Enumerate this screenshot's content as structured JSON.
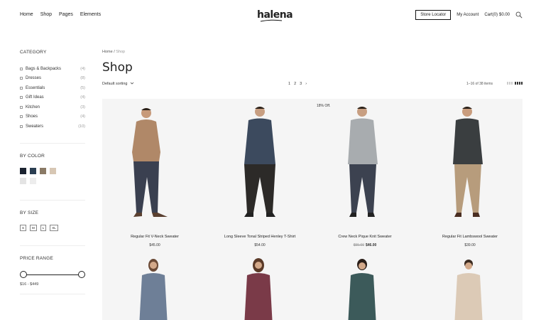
{
  "header": {
    "nav": [
      "Home",
      "Shop",
      "Pages",
      "Elements"
    ],
    "logo": "halena",
    "store_locator": "Store Locator",
    "my_account": "My Account",
    "cart_label": "Cart(0)",
    "cart_total": "$0.00"
  },
  "sidebar": {
    "category_title": "CATEGORY",
    "categories": [
      {
        "label": "Bags & Backpacks",
        "count": "(4)"
      },
      {
        "label": "Dresses",
        "count": "(8)"
      },
      {
        "label": "Essentials",
        "count": "(5)"
      },
      {
        "label": "Gift Ideas",
        "count": "(4)"
      },
      {
        "label": "Kitchen",
        "count": "(3)"
      },
      {
        "label": "Shoes",
        "count": "(4)"
      },
      {
        "label": "Sweaters",
        "count": "(10)"
      }
    ],
    "color_title": "BY COLOR",
    "colors": [
      "#1b2330",
      "#2b3e52",
      "#8a7a66",
      "#d7c7b4",
      "#e4e4e4",
      "#ededed"
    ],
    "size_title": "BY SIZE",
    "sizes": [
      "S",
      "M",
      "L",
      "XL"
    ],
    "price_title": "PRICE RANGE",
    "price_range": "$16 - $449"
  },
  "main": {
    "breadcrumb_home": "Home",
    "breadcrumb_sep": "/",
    "breadcrumb_current": "Shop",
    "title": "Shop",
    "sort_label": "Default sorting",
    "pages": [
      "1",
      "2",
      "3",
      "›"
    ],
    "items_count": "1–16 of 38 items",
    "sale_badge": "18% Off.",
    "products": [
      {
        "name": "Regular Fit V-Neck Sweater",
        "price": "$45.00",
        "old_price": ""
      },
      {
        "name": "Long Sleeve Tonal Striped Henley T-Shirt",
        "price": "$54.00",
        "old_price": ""
      },
      {
        "name": "Crew Neck Pique Knit Sweater",
        "price": "$46.00",
        "old_price": "$55.00"
      },
      {
        "name": "Regular Fit Lambswool Sweater",
        "price": "$39.00",
        "old_price": ""
      }
    ]
  }
}
